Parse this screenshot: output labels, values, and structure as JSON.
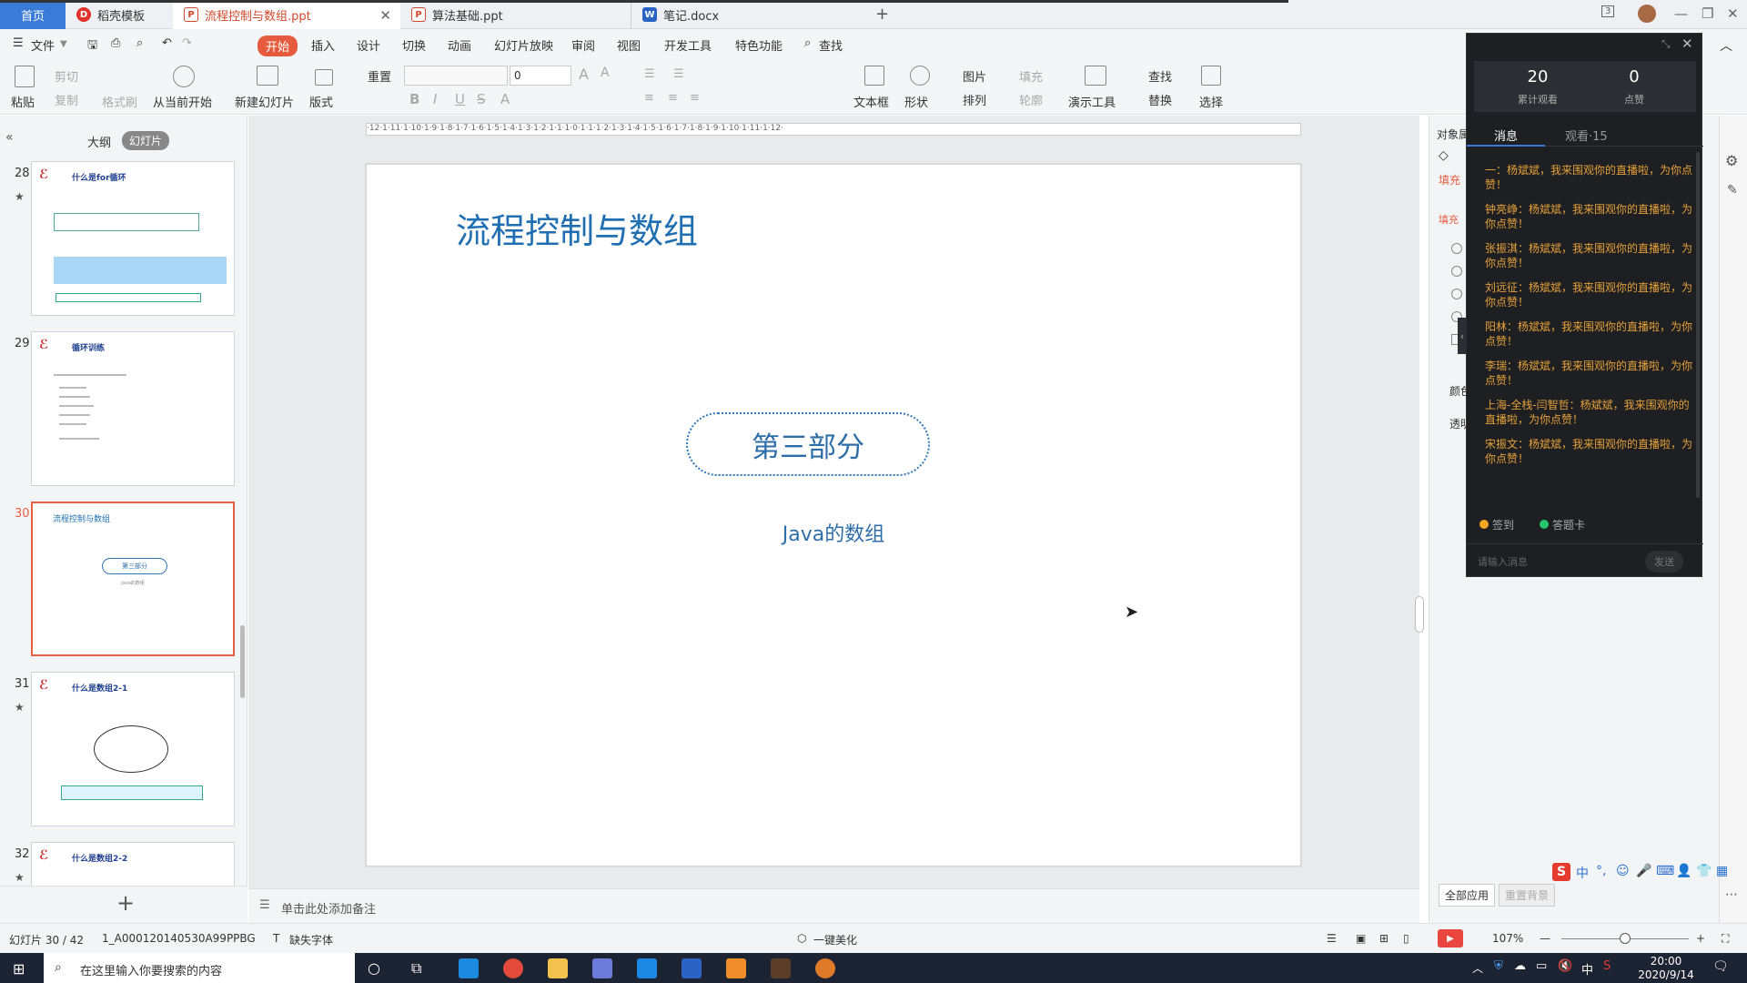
{
  "tabs": {
    "home": "首页",
    "daoke": "稻壳模板",
    "ppt": "流程控制与数组.ppt",
    "algo": "算法基础.ppt",
    "note": "笔记.docx",
    "new_tab": "+"
  },
  "menu": {
    "file": "文件",
    "start": "开始",
    "insert": "插入",
    "design": "设计",
    "switch": "切换",
    "animation": "动画",
    "slideshow": "幻灯片放映",
    "review": "审阅",
    "view": "视图",
    "devtools": "开发工具",
    "special": "特色功能",
    "search": "查找"
  },
  "ribbon": {
    "paste": "粘贴",
    "cut": "剪切",
    "copy": "复制",
    "format_painter": "格式刷",
    "from_current": "从当前开始",
    "new_slide": "新建幻灯片",
    "layout": "版式",
    "reset": "重置",
    "font_size": "0",
    "textbox": "文本框",
    "shape": "形状",
    "picture": "图片",
    "fill": "填充",
    "arrange": "排列",
    "outline": "轮廓",
    "presentation_tools": "演示工具",
    "find": "查找",
    "replace": "替换",
    "select": "选择"
  },
  "left_panel": {
    "outline_tab": "大纲",
    "slides_tab": "幻灯片",
    "add_slide": "+",
    "thumbs": [
      {
        "num": "28",
        "title": "什么是for循环"
      },
      {
        "num": "29",
        "title": "循环训练"
      },
      {
        "num": "30",
        "title": "流程控制与数组",
        "oval": "第三部分",
        "sub": "Java的数组"
      },
      {
        "num": "31",
        "title": "什么是数组2-1"
      },
      {
        "num": "32",
        "title": "什么是数组2-2"
      }
    ]
  },
  "slide": {
    "title": "流程控制与数组",
    "oval_text": "第三部分",
    "subtitle": "Java的数组"
  },
  "ruler": "·12·1·11·1·10·1·9·1·8·1·7·1·6·1·5·1·4·1·3·1·2·1·1·1·0·1·1·1·2·1·3·1·4·1·5·1·6·1·7·1·8·1·9·1·10·1·11·1·12·",
  "right_panel": {
    "object_props": "对象属",
    "fill_tab": "填充",
    "fill_section": "填充",
    "color_label": "颜色",
    "transparency_label": "透明",
    "apply_all": "全部应用",
    "reset_bg": "重置背景"
  },
  "live": {
    "views": "20",
    "views_label": "累计观看",
    "likes": "0",
    "likes_label": "点赞",
    "tab_messages": "消息",
    "tab_viewers": "观看·15",
    "messages": [
      "一：杨斌斌，我来围观你的直播啦，为你点赞！",
      "钟亮峥：杨斌斌，我来围观你的直播啦，为你点赞！",
      "张振淇：杨斌斌，我来围观你的直播啦，为你点赞！",
      "刘远征：杨斌斌，我来围观你的直播啦，为你点赞！",
      "阳林：杨斌斌，我来围观你的直播啦，为你点赞！",
      "李瑞：杨斌斌，我来围观你的直播啦，为你点赞！",
      "上海-全栈-闫智哲：杨斌斌，我来围观你的直播啦，为你点赞！",
      "宋振文：杨斌斌，我来围观你的直播啦，为你点赞！"
    ],
    "checkin": "签到",
    "answer_card": "答题卡",
    "input_placeholder": "请输入消息",
    "send": "发送"
  },
  "notes_placeholder": "单击此处添加备注",
  "status": {
    "slide_info": "幻灯片 30 / 42",
    "template": "1_A000120140530A99PPBG",
    "missing_font": "缺失字体",
    "beautify": "一键美化",
    "zoom": "107%"
  },
  "taskbar": {
    "search_placeholder": "在这里输入你要搜索的内容",
    "ime": "中",
    "time": "20:00",
    "date": "2020/9/14"
  },
  "colors": {
    "accent_orange": "#e65b3d",
    "slide_blue": "#1f6fb2",
    "chat_text": "#e6a13a",
    "taskbar_bg": "#1c2433"
  }
}
